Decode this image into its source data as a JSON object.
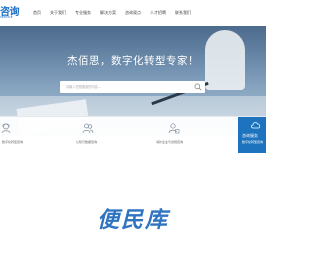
{
  "header": {
    "logo_text": "咨询",
    "logo_sub": "SERVICE",
    "nav": [
      "首页",
      "关于我们",
      "专业服务",
      "解决方案",
      "咨询观点",
      "人才招聘",
      "联系我们"
    ]
  },
  "hero": {
    "title": "杰佰思，数字化转型专家！",
    "search_placeholder": "请输入您想搜索的内容..."
  },
  "services": [
    {
      "label": "数字化转型咨询",
      "icon": "consultant-icon"
    },
    {
      "label": "认知与数据咨询",
      "icon": "group-icon"
    },
    {
      "label": "海外企业与合规咨询",
      "icon": "user-settings-icon"
    },
    {
      "title": "咨询服务",
      "label": "数字化转型咨询",
      "icon": "cloud-icon"
    }
  ],
  "brand": "便民库",
  "colors": {
    "accent": "#1e73be",
    "brand": "#2f74c0",
    "logo": "#1a6fc4"
  }
}
